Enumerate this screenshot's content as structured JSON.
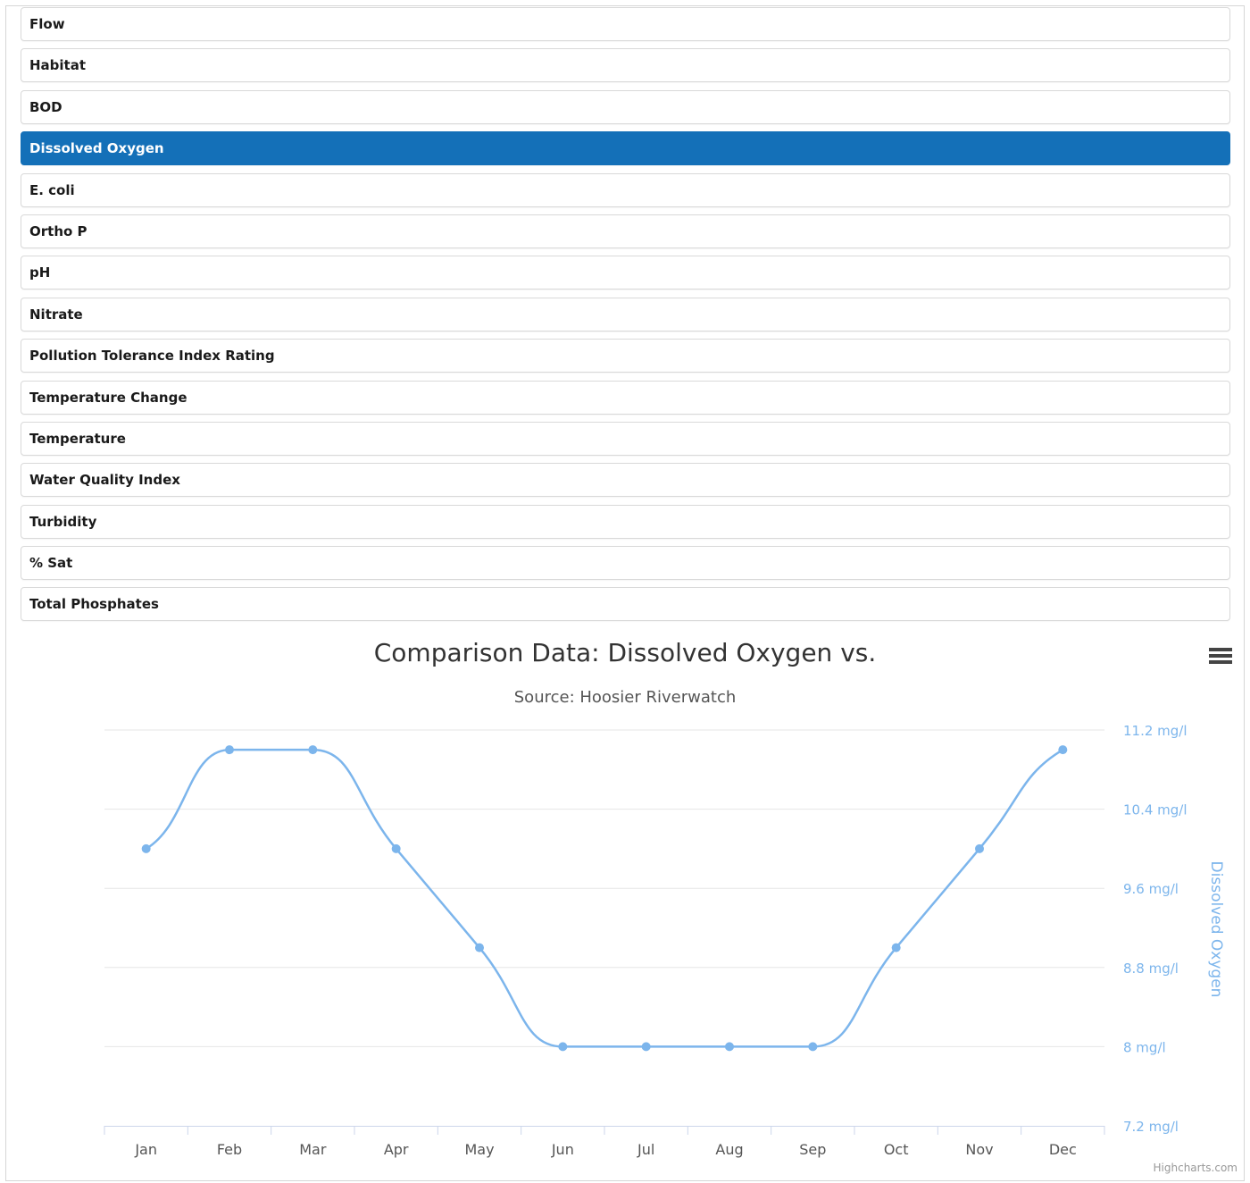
{
  "parameters": {
    "items": [
      {
        "label": "Flow",
        "active": false
      },
      {
        "label": "Habitat",
        "active": false
      },
      {
        "label": "BOD",
        "active": false
      },
      {
        "label": "Dissolved Oxygen",
        "active": true
      },
      {
        "label": "E. coli",
        "active": false
      },
      {
        "label": "Ortho P",
        "active": false
      },
      {
        "label": "pH",
        "active": false
      },
      {
        "label": "Nitrate",
        "active": false
      },
      {
        "label": "Pollution Tolerance Index Rating",
        "active": false
      },
      {
        "label": "Temperature Change",
        "active": false
      },
      {
        "label": "Temperature",
        "active": false
      },
      {
        "label": "Water Quality Index",
        "active": false
      },
      {
        "label": "Turbidity",
        "active": false
      },
      {
        "label": "% Sat",
        "active": false
      },
      {
        "label": "Total Phosphates",
        "active": false
      }
    ],
    "active_color": "#1470b8"
  },
  "chart": {
    "menu_icon": "hamburger-menu-icon",
    "credits": "Highcharts.com"
  },
  "chart_data": {
    "type": "line",
    "title": "Comparison Data: Dissolved Oxygen vs.",
    "subtitle": "Source: Hoosier Riverwatch",
    "categories": [
      "Jan",
      "Feb",
      "Mar",
      "Apr",
      "May",
      "Jun",
      "Jul",
      "Aug",
      "Sep",
      "Oct",
      "Nov",
      "Dec"
    ],
    "series": [
      {
        "values": [
          10.0,
          11.0,
          11.0,
          10.0,
          9.0,
          8.0,
          8.0,
          8.0,
          8.0,
          9.0,
          10.0,
          11.0
        ],
        "color": "#7cb5ec"
      }
    ],
    "ylabel": "Dissolved Oxygen",
    "yaxis_side": "right",
    "yticks": [
      "7.2 mg/l",
      "8 mg/l",
      "8.8 mg/l",
      "9.6 mg/l",
      "10.4 mg/l",
      "11.2 mg/l"
    ],
    "ytick_values": [
      7.2,
      8.0,
      8.8,
      9.6,
      10.4,
      11.2
    ],
    "ylim": [
      7.2,
      11.2
    ],
    "grid": true,
    "smooth": true
  }
}
